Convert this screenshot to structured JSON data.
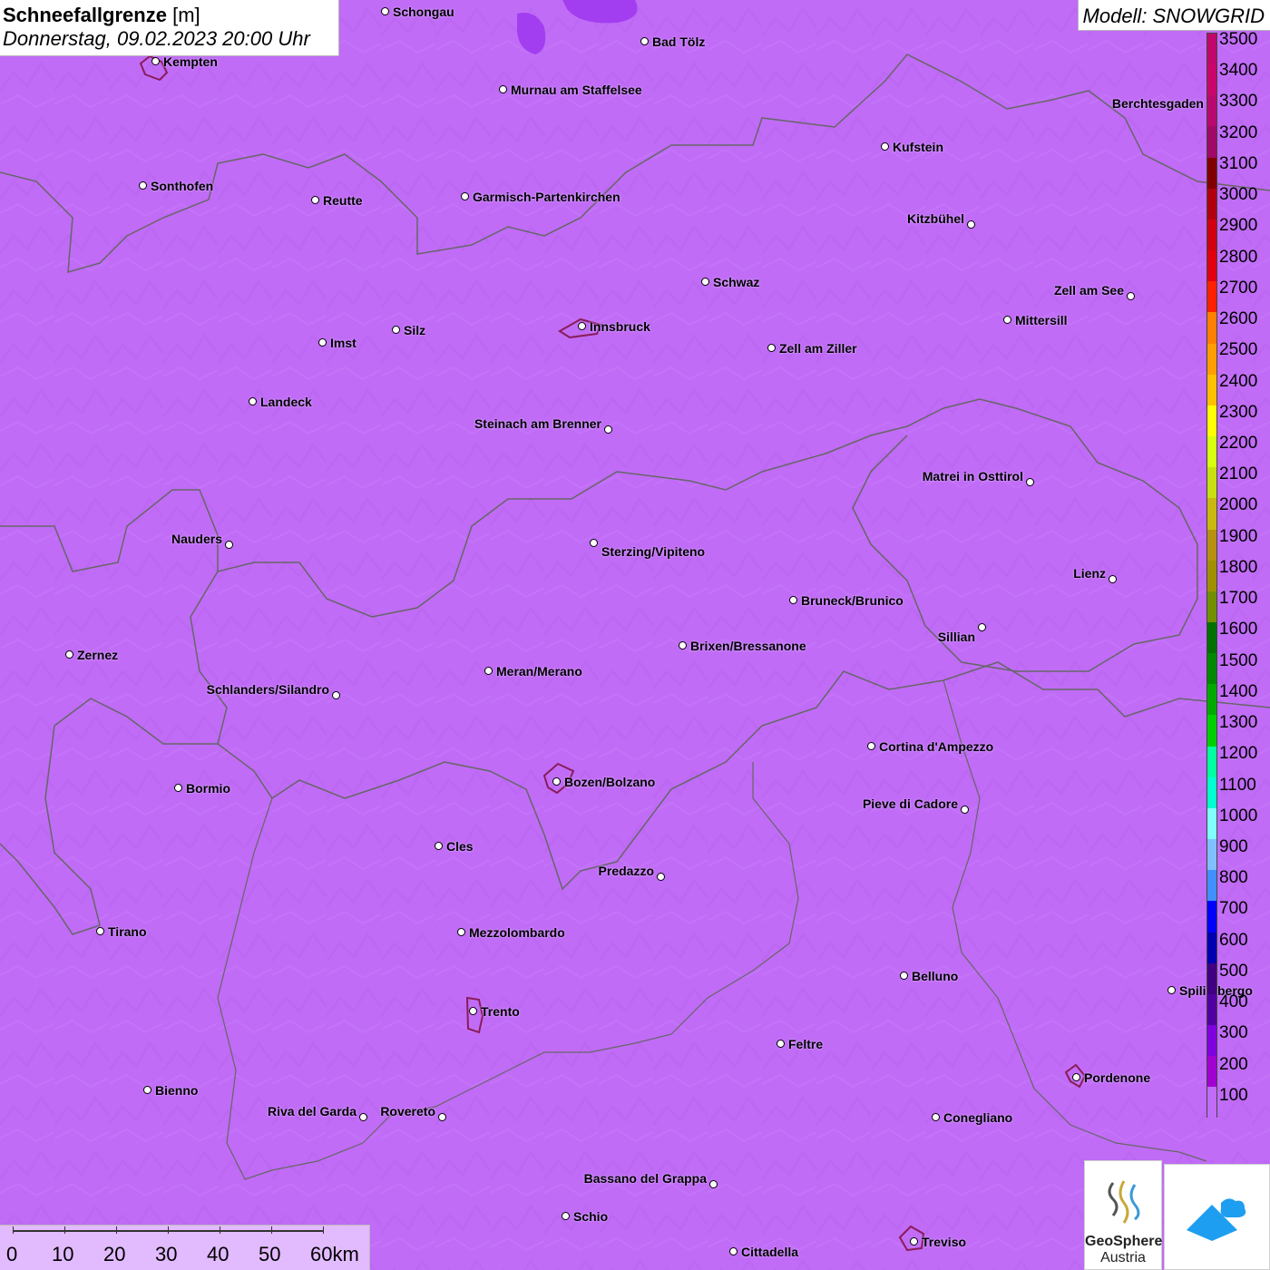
{
  "title": {
    "variable": "Schneefallgrenze",
    "unit": "[m]",
    "datetime": "Donnerstag, 09.02.2023 20:00 Uhr"
  },
  "model_label": "Modell: SNOWGRID",
  "legend": {
    "labels": [
      "3500",
      "3400",
      "3300",
      "3200",
      "3100",
      "3000",
      "2900",
      "2800",
      "2700",
      "2600",
      "2500",
      "2400",
      "2300",
      "2200",
      "2100",
      "2000",
      "1900",
      "1800",
      "1700",
      "1600",
      "1500",
      "1400",
      "1300",
      "1200",
      "1100",
      "1000",
      "900",
      "800",
      "700",
      "600",
      "500",
      "400",
      "300",
      "200",
      "100"
    ],
    "colors": [
      "#c0086a",
      "#c8066a",
      "#b80a6e",
      "#a00a66",
      "#800000",
      "#b00010",
      "#d00010",
      "#e00010",
      "#ff2000",
      "#ff8000",
      "#ff9e00",
      "#ffc000",
      "#ffff00",
      "#d8ff10",
      "#c8e010",
      "#c8b810",
      "#b89010",
      "#a09000",
      "#709000",
      "#007000",
      "#008800",
      "#00aa00",
      "#00d000",
      "#00ffa0",
      "#00ffd0",
      "#80ffff",
      "#80c0ff",
      "#4090ff",
      "#0000ff",
      "#0000b0",
      "#400080",
      "#5000a0",
      "#8000e0",
      "#a000d0",
      "#c06cf6"
    ]
  },
  "cities": [
    {
      "name": "Schongau"
    },
    {
      "name": "Bad Tölz"
    },
    {
      "name": "Kempten"
    },
    {
      "name": "Murnau am Staffelsee"
    },
    {
      "name": "Berchtesgaden"
    },
    {
      "name": "Kufstein"
    },
    {
      "name": "Sonthofen"
    },
    {
      "name": "Reutte"
    },
    {
      "name": "Garmisch-Partenkirchen"
    },
    {
      "name": "Kitzbühel"
    },
    {
      "name": "Schwaz"
    },
    {
      "name": "Zell am See"
    },
    {
      "name": "Innsbruck"
    },
    {
      "name": "Mittersill"
    },
    {
      "name": "Silz"
    },
    {
      "name": "Imst"
    },
    {
      "name": "Zell am Ziller"
    },
    {
      "name": "Landeck"
    },
    {
      "name": "Steinach am Brenner"
    },
    {
      "name": "Matrei in Osttirol"
    },
    {
      "name": "Nauders"
    },
    {
      "name": "Sterzing/Vipiteno"
    },
    {
      "name": "Lienz"
    },
    {
      "name": "Bruneck/Brunico"
    },
    {
      "name": "Sillian"
    },
    {
      "name": "Brixen/Bressanone"
    },
    {
      "name": "Zernez"
    },
    {
      "name": "Meran/Merano"
    },
    {
      "name": "Schlanders/Silandro"
    },
    {
      "name": "Cortina d'Ampezzo"
    },
    {
      "name": "Bozen/Bolzano"
    },
    {
      "name": "Bormio"
    },
    {
      "name": "Pieve di Cadore"
    },
    {
      "name": "Cles"
    },
    {
      "name": "Predazzo"
    },
    {
      "name": "Tirano"
    },
    {
      "name": "Mezzolombardo"
    },
    {
      "name": "Belluno"
    },
    {
      "name": "Spilimbergo"
    },
    {
      "name": "Trento"
    },
    {
      "name": "Feltre"
    },
    {
      "name": "Pordenone"
    },
    {
      "name": "Bienno"
    },
    {
      "name": "Riva del Garda"
    },
    {
      "name": "Rovereto"
    },
    {
      "name": "Conegliano"
    },
    {
      "name": "Bassano del Grappa"
    },
    {
      "name": "Schio"
    },
    {
      "name": "Treviso"
    },
    {
      "name": "Cittadella"
    }
  ],
  "scale": {
    "labels": [
      "0",
      "10",
      "20",
      "30",
      "40",
      "50",
      "60km"
    ]
  },
  "logos": {
    "geosphere_line1": "GeoSphere",
    "geosphere_line2": "Austria"
  }
}
